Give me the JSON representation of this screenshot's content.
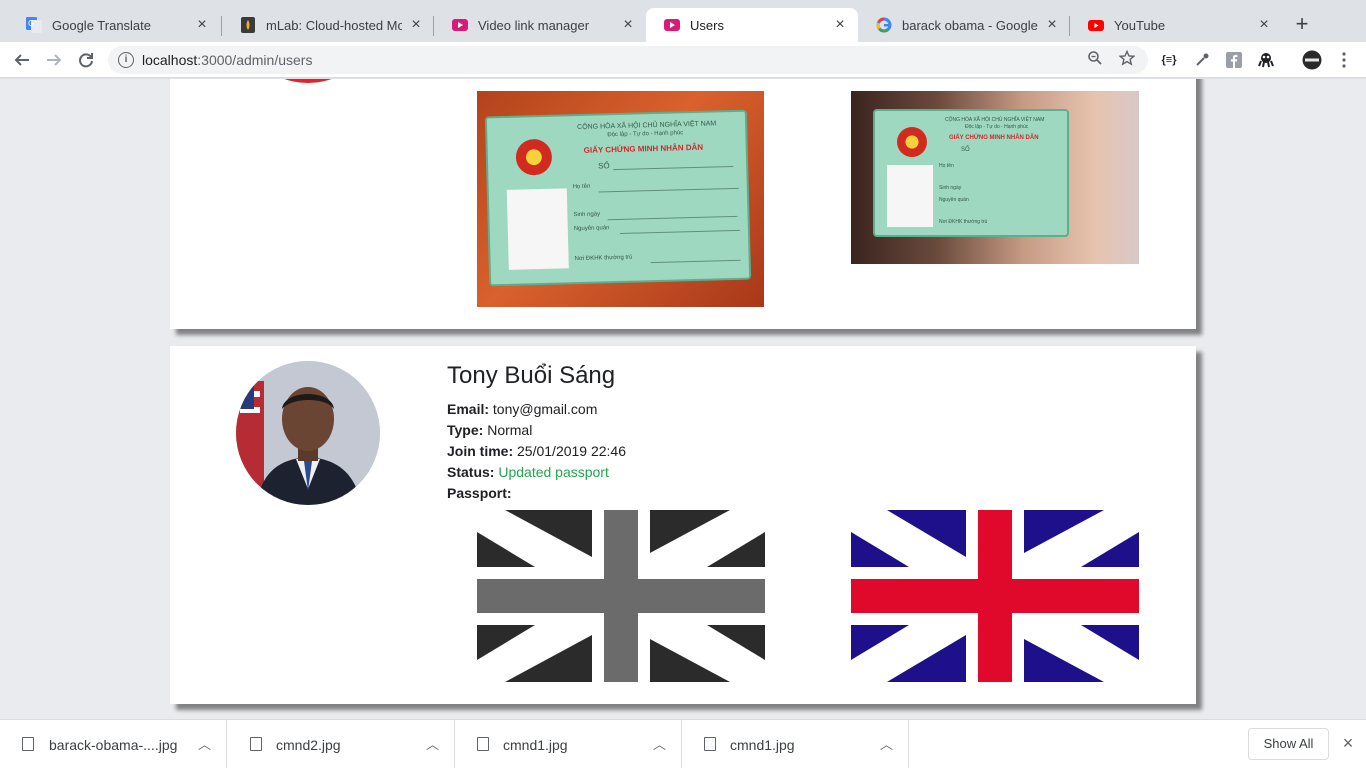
{
  "tabs": [
    {
      "title": "Google Translate",
      "icon": "google-translate-icon"
    },
    {
      "title": "mLab: Cloud-hosted MongoDB",
      "icon": "mlab-icon"
    },
    {
      "title": "Video link manager",
      "icon": "video-manager-icon"
    },
    {
      "title": "Users",
      "icon": "video-manager-icon",
      "active": true
    },
    {
      "title": "barack obama - Google Search",
      "icon": "google-icon"
    },
    {
      "title": "YouTube",
      "icon": "youtube-icon"
    }
  ],
  "address_bar": {
    "host": "localhost",
    "path": ":3000/admin/users"
  },
  "users": [
    {
      "id_card_text": {
        "header1": "CỘNG HÒA XÃ HỘI CHỦ NGHĨA VIỆT NAM",
        "header2": "Độc lập - Tự do - Hạnh phúc",
        "title": "GIẤY CHỨNG MINH NHÂN DÂN",
        "so": "SỐ",
        "ho_ten": "Họ tên",
        "sinh_ngay": "Sinh ngày",
        "nguyen_quan": "Nguyên quán",
        "noi_dkhk": "Nơi ĐKHK thường trú"
      }
    },
    {
      "name": "Tony Buổi Sáng",
      "email_label": "Email:",
      "email": "tony@gmail.com",
      "type_label": "Type:",
      "type": "Normal",
      "join_label": "Join time:",
      "join_time": "25/01/2019 22:46",
      "status_label": "Status:",
      "status": "Updated passport",
      "status_color": "#1fa64a",
      "passport_label": "Passport:"
    }
  ],
  "flag_colors": {
    "gray_dark": "#2b2b2b",
    "gray_mid": "#6b6b6b",
    "blue": "#1e0f8a",
    "red": "#e0082b"
  },
  "downloads": [
    {
      "name": "barack-obama-....jpg"
    },
    {
      "name": "cmnd2.jpg"
    },
    {
      "name": "cmnd1.jpg"
    },
    {
      "name": "cmnd1.jpg"
    }
  ],
  "downloads_show_all": "Show All"
}
